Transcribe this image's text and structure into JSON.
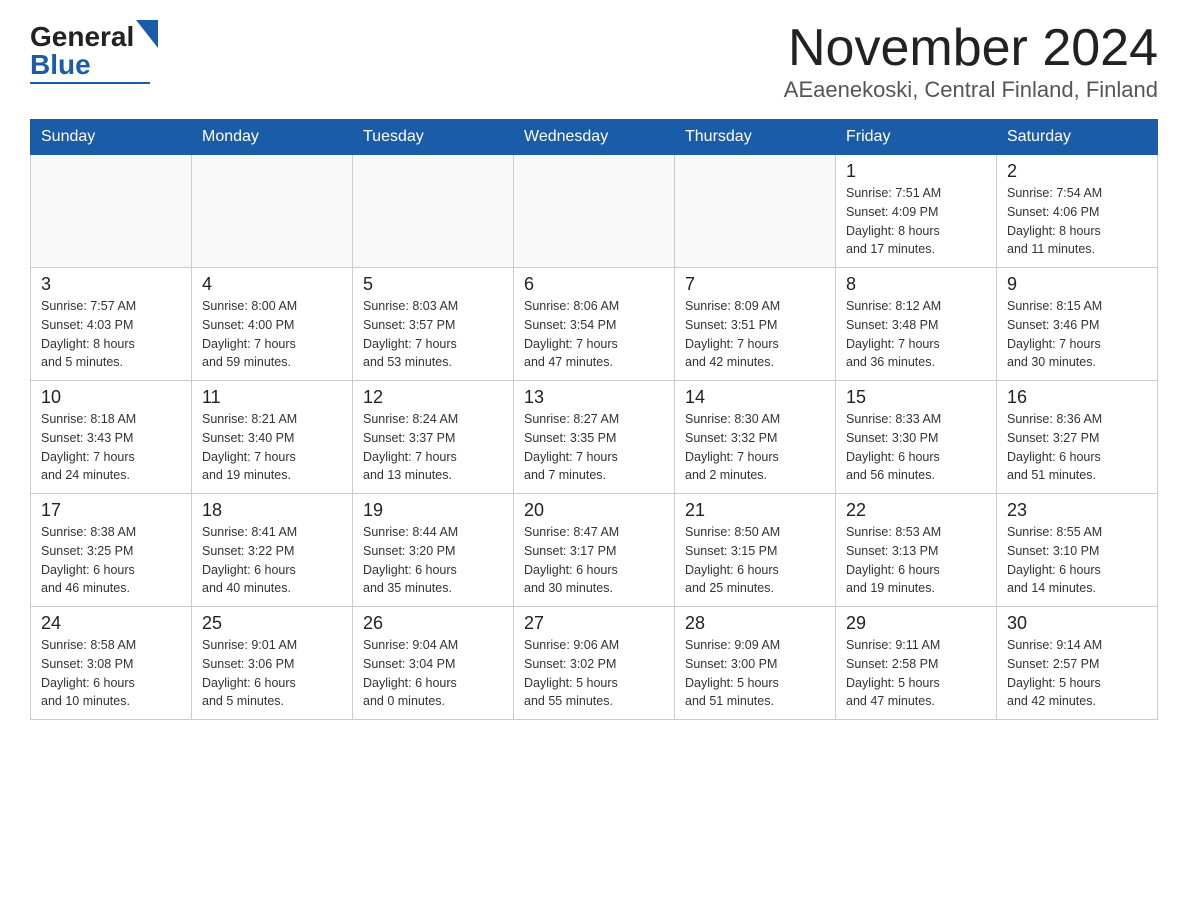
{
  "logo": {
    "general": "General",
    "blue": "Blue"
  },
  "title": "November 2024",
  "subtitle": "AEaenekoski, Central Finland, Finland",
  "days_of_week": [
    "Sunday",
    "Monday",
    "Tuesday",
    "Wednesday",
    "Thursday",
    "Friday",
    "Saturday"
  ],
  "weeks": [
    [
      {
        "day": "",
        "info": ""
      },
      {
        "day": "",
        "info": ""
      },
      {
        "day": "",
        "info": ""
      },
      {
        "day": "",
        "info": ""
      },
      {
        "day": "",
        "info": ""
      },
      {
        "day": "1",
        "info": "Sunrise: 7:51 AM\nSunset: 4:09 PM\nDaylight: 8 hours\nand 17 minutes."
      },
      {
        "day": "2",
        "info": "Sunrise: 7:54 AM\nSunset: 4:06 PM\nDaylight: 8 hours\nand 11 minutes."
      }
    ],
    [
      {
        "day": "3",
        "info": "Sunrise: 7:57 AM\nSunset: 4:03 PM\nDaylight: 8 hours\nand 5 minutes."
      },
      {
        "day": "4",
        "info": "Sunrise: 8:00 AM\nSunset: 4:00 PM\nDaylight: 7 hours\nand 59 minutes."
      },
      {
        "day": "5",
        "info": "Sunrise: 8:03 AM\nSunset: 3:57 PM\nDaylight: 7 hours\nand 53 minutes."
      },
      {
        "day": "6",
        "info": "Sunrise: 8:06 AM\nSunset: 3:54 PM\nDaylight: 7 hours\nand 47 minutes."
      },
      {
        "day": "7",
        "info": "Sunrise: 8:09 AM\nSunset: 3:51 PM\nDaylight: 7 hours\nand 42 minutes."
      },
      {
        "day": "8",
        "info": "Sunrise: 8:12 AM\nSunset: 3:48 PM\nDaylight: 7 hours\nand 36 minutes."
      },
      {
        "day": "9",
        "info": "Sunrise: 8:15 AM\nSunset: 3:46 PM\nDaylight: 7 hours\nand 30 minutes."
      }
    ],
    [
      {
        "day": "10",
        "info": "Sunrise: 8:18 AM\nSunset: 3:43 PM\nDaylight: 7 hours\nand 24 minutes."
      },
      {
        "day": "11",
        "info": "Sunrise: 8:21 AM\nSunset: 3:40 PM\nDaylight: 7 hours\nand 19 minutes."
      },
      {
        "day": "12",
        "info": "Sunrise: 8:24 AM\nSunset: 3:37 PM\nDaylight: 7 hours\nand 13 minutes."
      },
      {
        "day": "13",
        "info": "Sunrise: 8:27 AM\nSunset: 3:35 PM\nDaylight: 7 hours\nand 7 minutes."
      },
      {
        "day": "14",
        "info": "Sunrise: 8:30 AM\nSunset: 3:32 PM\nDaylight: 7 hours\nand 2 minutes."
      },
      {
        "day": "15",
        "info": "Sunrise: 8:33 AM\nSunset: 3:30 PM\nDaylight: 6 hours\nand 56 minutes."
      },
      {
        "day": "16",
        "info": "Sunrise: 8:36 AM\nSunset: 3:27 PM\nDaylight: 6 hours\nand 51 minutes."
      }
    ],
    [
      {
        "day": "17",
        "info": "Sunrise: 8:38 AM\nSunset: 3:25 PM\nDaylight: 6 hours\nand 46 minutes."
      },
      {
        "day": "18",
        "info": "Sunrise: 8:41 AM\nSunset: 3:22 PM\nDaylight: 6 hours\nand 40 minutes."
      },
      {
        "day": "19",
        "info": "Sunrise: 8:44 AM\nSunset: 3:20 PM\nDaylight: 6 hours\nand 35 minutes."
      },
      {
        "day": "20",
        "info": "Sunrise: 8:47 AM\nSunset: 3:17 PM\nDaylight: 6 hours\nand 30 minutes."
      },
      {
        "day": "21",
        "info": "Sunrise: 8:50 AM\nSunset: 3:15 PM\nDaylight: 6 hours\nand 25 minutes."
      },
      {
        "day": "22",
        "info": "Sunrise: 8:53 AM\nSunset: 3:13 PM\nDaylight: 6 hours\nand 19 minutes."
      },
      {
        "day": "23",
        "info": "Sunrise: 8:55 AM\nSunset: 3:10 PM\nDaylight: 6 hours\nand 14 minutes."
      }
    ],
    [
      {
        "day": "24",
        "info": "Sunrise: 8:58 AM\nSunset: 3:08 PM\nDaylight: 6 hours\nand 10 minutes."
      },
      {
        "day": "25",
        "info": "Sunrise: 9:01 AM\nSunset: 3:06 PM\nDaylight: 6 hours\nand 5 minutes."
      },
      {
        "day": "26",
        "info": "Sunrise: 9:04 AM\nSunset: 3:04 PM\nDaylight: 6 hours\nand 0 minutes."
      },
      {
        "day": "27",
        "info": "Sunrise: 9:06 AM\nSunset: 3:02 PM\nDaylight: 5 hours\nand 55 minutes."
      },
      {
        "day": "28",
        "info": "Sunrise: 9:09 AM\nSunset: 3:00 PM\nDaylight: 5 hours\nand 51 minutes."
      },
      {
        "day": "29",
        "info": "Sunrise: 9:11 AM\nSunset: 2:58 PM\nDaylight: 5 hours\nand 47 minutes."
      },
      {
        "day": "30",
        "info": "Sunrise: 9:14 AM\nSunset: 2:57 PM\nDaylight: 5 hours\nand 42 minutes."
      }
    ]
  ]
}
